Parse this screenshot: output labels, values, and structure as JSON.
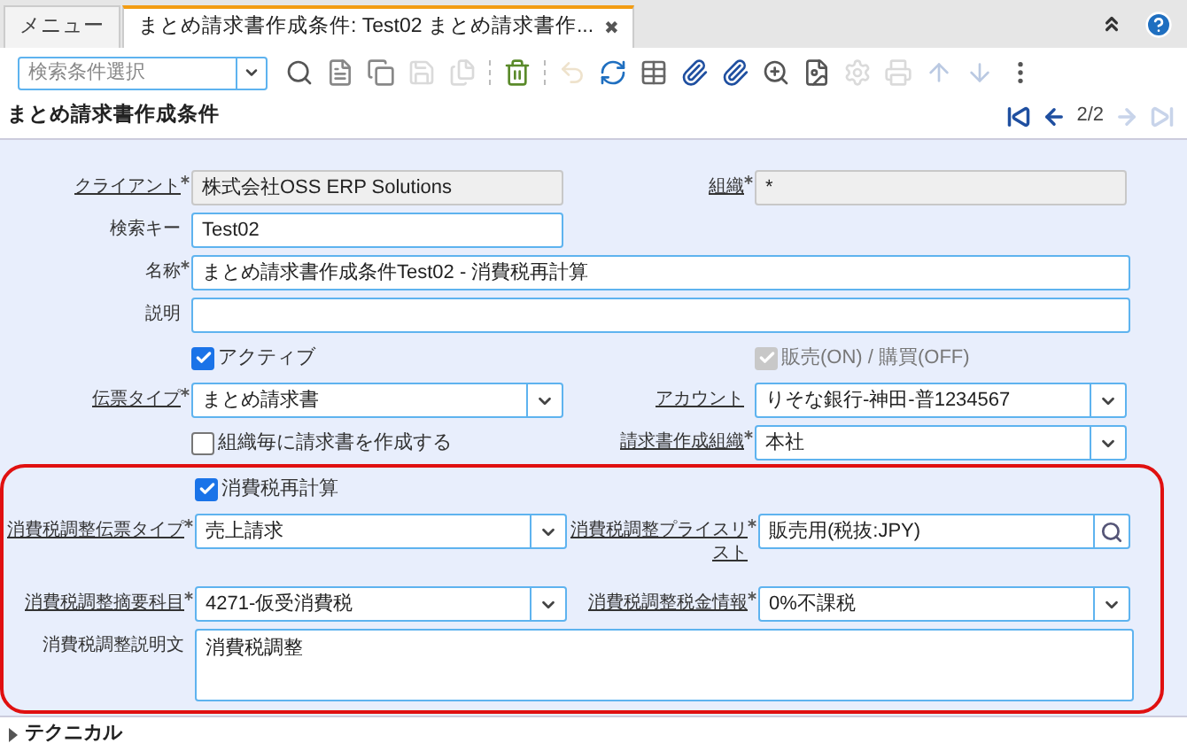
{
  "tabs": [
    {
      "label": "メニュー",
      "selected": false,
      "closable": false
    },
    {
      "label": "まとめ請求書作成条件: Test02 まとめ請求書作...",
      "selected": true,
      "closable": true
    }
  ],
  "tab_close": "✖",
  "search": {
    "placeholder": "検索条件選択"
  },
  "toolbar": [
    {
      "disabled": false
    },
    {
      "disabled": false
    },
    {
      "disabled": false
    },
    {
      "disabled": true
    },
    {
      "disabled": true
    },
    {
      "disabled": false
    },
    {
      "disabled": true
    },
    {
      "disabled": false
    },
    {
      "disabled": false
    },
    {
      "disabled": false
    },
    {
      "disabled": false
    },
    {
      "disabled": false
    },
    {
      "disabled": false
    },
    {
      "disabled": true
    },
    {
      "disabled": true
    },
    {
      "disabled": true
    },
    {
      "disabled": true
    },
    {
      "disabled": false
    }
  ],
  "header": {
    "title": "まとめ請求書作成条件",
    "record": "2/2",
    "first_disabled": false,
    "prev_disabled": false,
    "next_disabled": true,
    "last_disabled": true
  },
  "rows": [
    {
      "highlight": false,
      "cells": [
        {
          "kind": "readonly",
          "label": "クライアント",
          "link": true,
          "required": true,
          "value": "株式会社OSS ERP Solutions"
        },
        {
          "kind": "readonly",
          "label": "組織",
          "link": true,
          "required": true,
          "value": "*"
        }
      ]
    },
    {
      "highlight": false,
      "cells": [
        {
          "kind": "text",
          "label": "検索キー",
          "link": false,
          "required": false,
          "value": "Test02"
        }
      ]
    },
    {
      "highlight": false,
      "cells": [
        {
          "kind": "wide",
          "label": "名称",
          "link": false,
          "required": true,
          "value": "まとめ請求書作成条件Test02 - 消費税再計算"
        }
      ]
    },
    {
      "highlight": false,
      "cells": [
        {
          "kind": "wide",
          "label": "説明",
          "link": false,
          "required": false
        }
      ]
    },
    {
      "highlight": false,
      "cells": [
        {
          "kind": "checkbox",
          "label": "アクティブ",
          "checked": true,
          "disabled": false
        },
        {
          "kind": "checkbox",
          "label": "販売(ON) / 購買(OFF)",
          "checked": true,
          "disabled": true
        }
      ]
    },
    {
      "highlight": false,
      "cells": [
        {
          "kind": "select",
          "label": "伝票タイプ",
          "link": true,
          "required": true,
          "value": "まとめ請求書"
        },
        {
          "kind": "select",
          "label": "アカウント",
          "link": true,
          "required": false,
          "value": "りそな銀行-神田-普1234567"
        }
      ]
    },
    {
      "highlight": false,
      "cells": [
        {
          "kind": "checkbox",
          "label": "組織毎に請求書を作成する",
          "checked": false,
          "disabled": false
        },
        {
          "kind": "select",
          "label": "請求書作成組織",
          "link": true,
          "required": true,
          "value": "本社"
        }
      ]
    },
    {
      "highlight": true,
      "cells": [
        {
          "kind": "checkbox",
          "label": "消費税再計算",
          "checked": true,
          "disabled": false
        }
      ]
    },
    {
      "highlight": true,
      "cells": [
        {
          "kind": "select",
          "label": "消費税調整伝票タイプ",
          "link": true,
          "required": true,
          "value": "売上請求"
        },
        {
          "kind": "search",
          "label": "消費税調整プライスリスト",
          "link": true,
          "required": true,
          "value": "販売用(税抜:JPY)"
        }
      ]
    },
    {
      "highlight": true,
      "cells": [
        {
          "kind": "select",
          "label": "消費税調整摘要科目",
          "link": true,
          "required": true,
          "value": "4271-仮受消費税"
        },
        {
          "kind": "select",
          "label": "消費税調整税金情報",
          "link": true,
          "required": true,
          "value": "0%不課税"
        }
      ]
    },
    {
      "highlight": true,
      "cells": [
        {
          "kind": "textarea",
          "label": "消費税調整説明文",
          "link": false,
          "required": false,
          "value": "消費税調整"
        }
      ]
    }
  ],
  "sections": [
    {
      "label": "テクニカル",
      "expanded": false
    }
  ]
}
